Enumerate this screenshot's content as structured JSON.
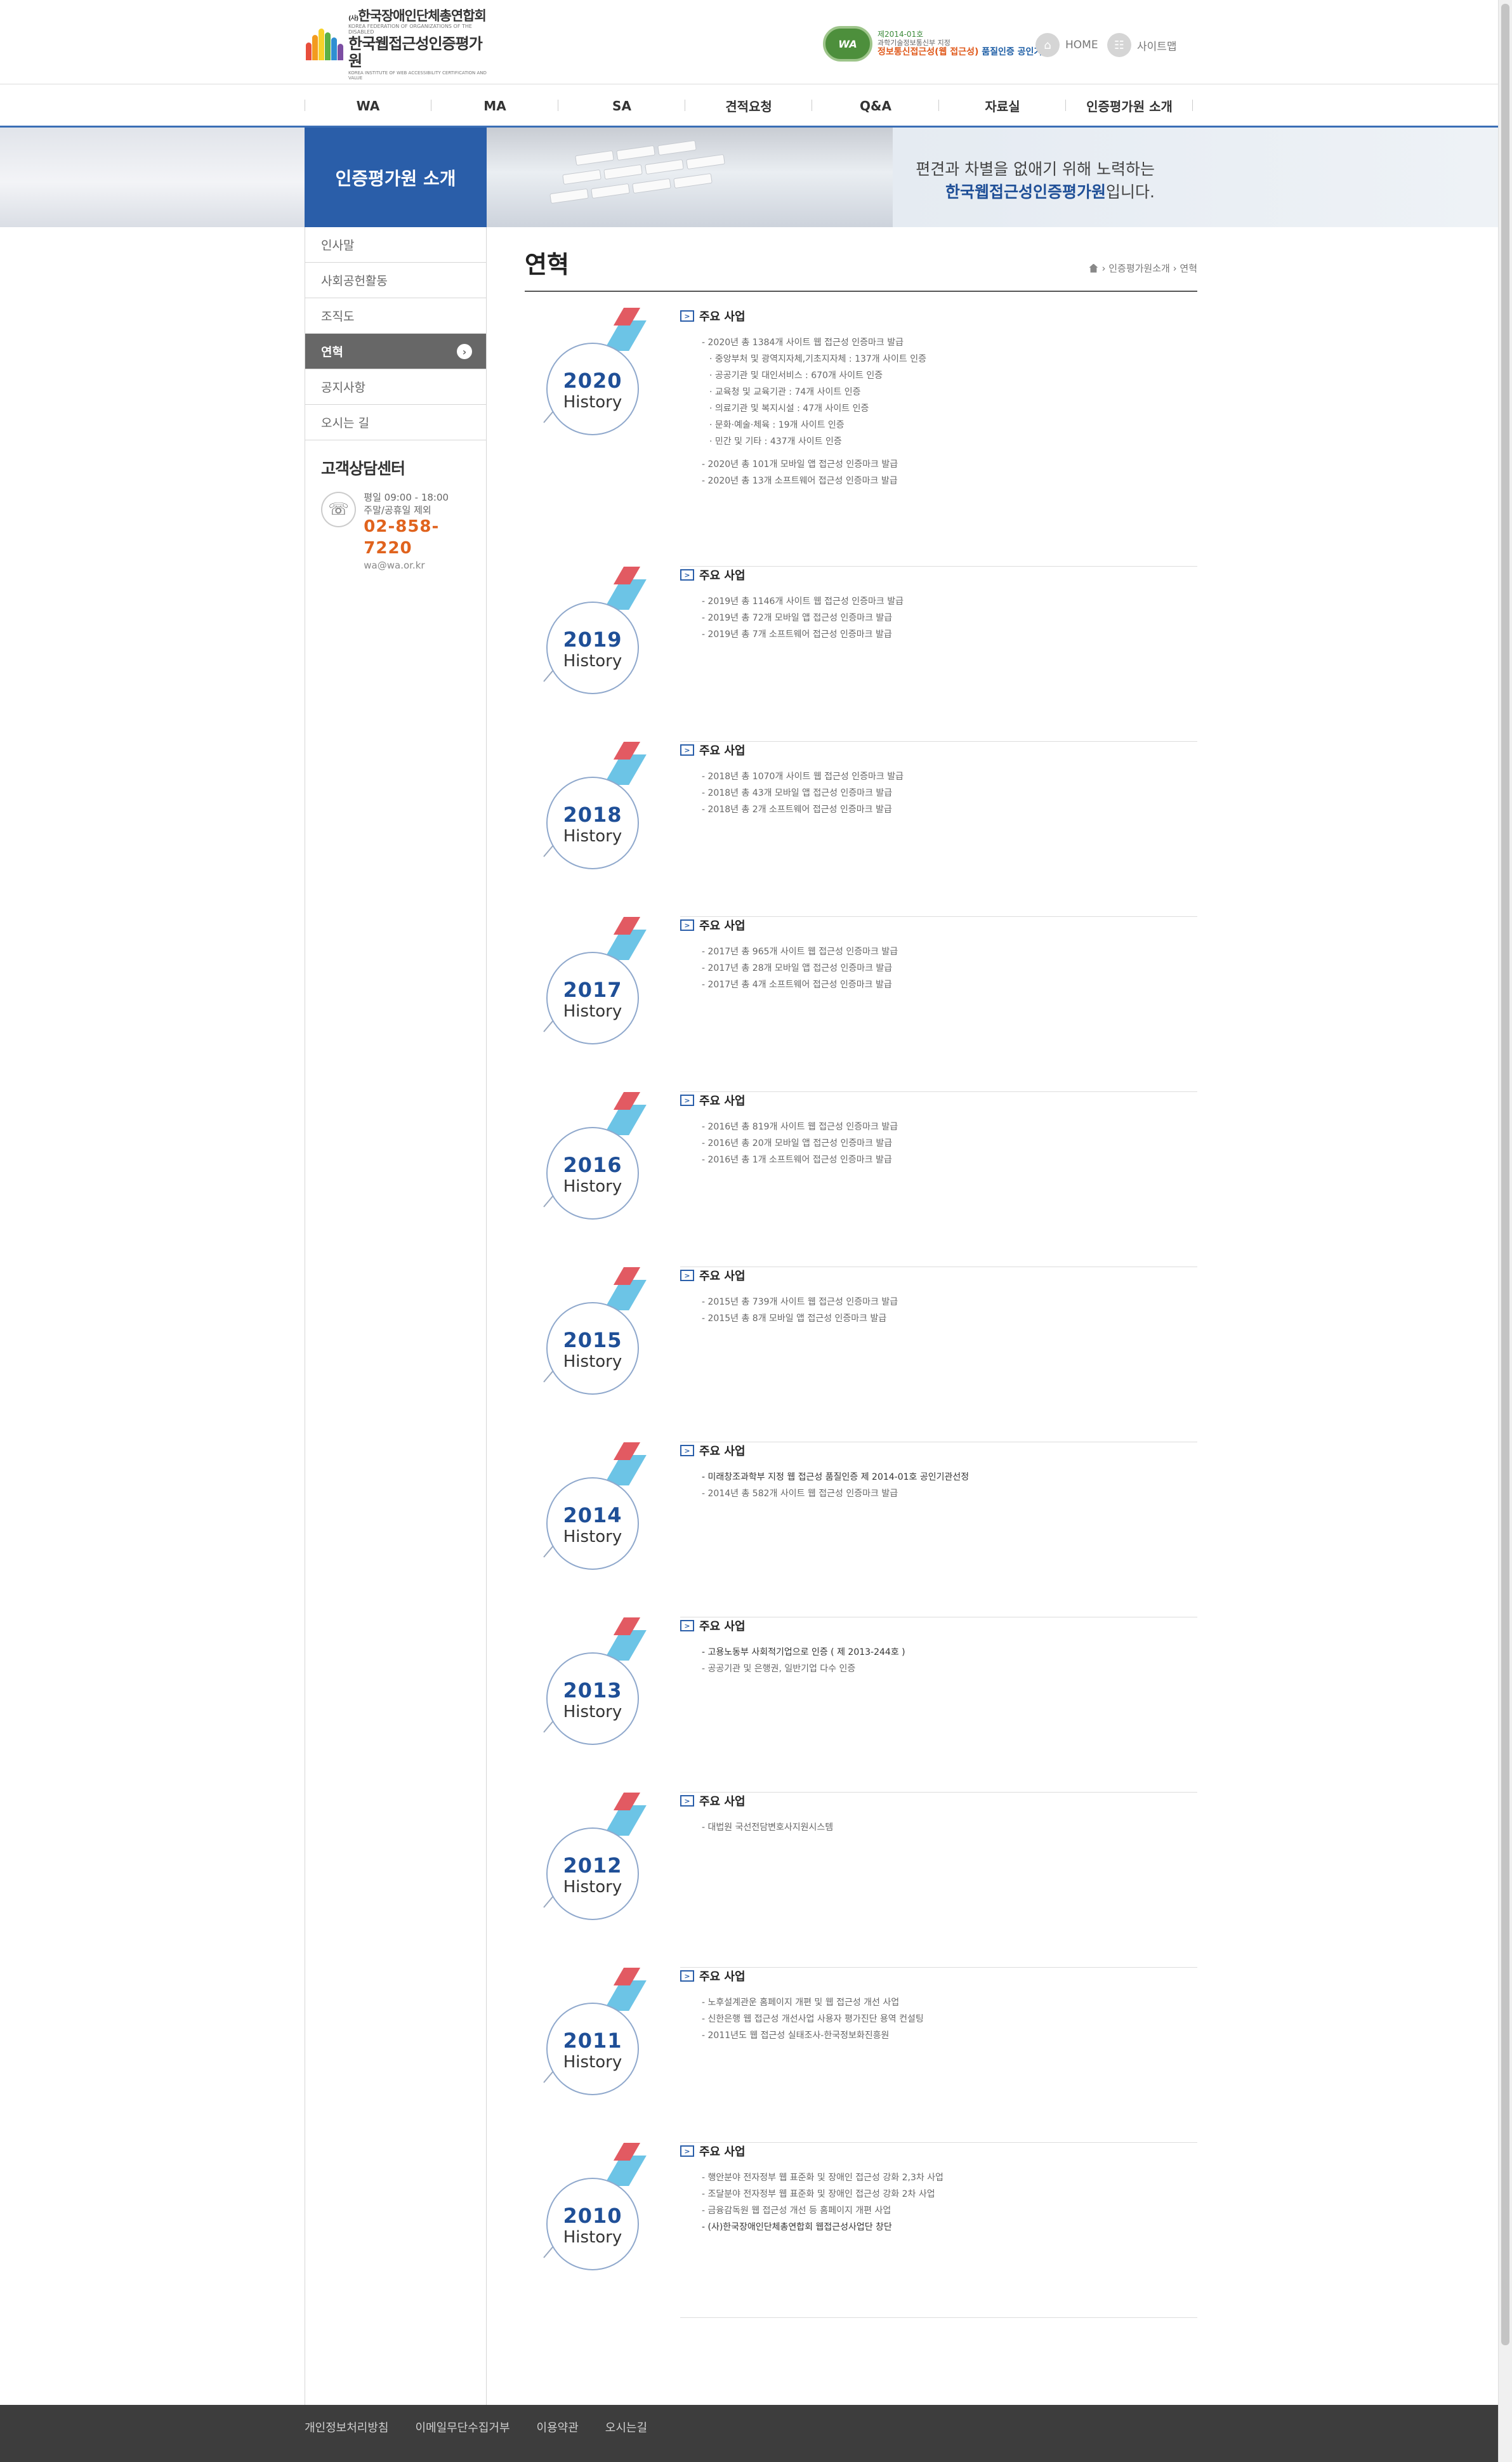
{
  "header": {
    "logo": {
      "org_small": "(사)",
      "org_name": "한국장애인단체총연합회",
      "org_en": "KOREA FEDERATION OF ORGANIZATIONS OF THE DISABLED",
      "brand_name": "한국웹접근성인증평가원",
      "brand_en": "KOREA INSTITUTE OF WEB ACCESSIBILITY CERTIFICATION AND VALUE"
    },
    "cert": {
      "badge": "WA",
      "line1": "제2014-01호",
      "line2": "과학기술정보통신부 지정",
      "line3_a": "정보통신접근성(웹 접근성)",
      "line3_b": "품질인증 공인기관"
    },
    "utils": [
      {
        "label": "HOME",
        "icon": "home-icon"
      },
      {
        "label": "사이트맵",
        "icon": "sitemap-icon"
      }
    ]
  },
  "nav": [
    "WA",
    "MA",
    "SA",
    "견적요청",
    "Q&A",
    "자료실",
    "인증평가원 소개"
  ],
  "banner": {
    "section_title": "인증평가원 소개",
    "copy_line1": "편견과 차별을 없애기 위해 노력하는",
    "copy_line2_strong": "한국웹접근성인증평가원",
    "copy_line2_rest": "입니다."
  },
  "sidebar": {
    "items": [
      {
        "label": "인사말",
        "active": false
      },
      {
        "label": "사회공헌활동",
        "active": false
      },
      {
        "label": "조직도",
        "active": false
      },
      {
        "label": "연혁",
        "active": true
      },
      {
        "label": "공지사항",
        "active": false
      },
      {
        "label": "오시는 길",
        "active": false
      }
    ],
    "cs": {
      "title": "고객상담센터",
      "hours": "평일 09:00 - 18:00",
      "holiday": "주말/공휴일 제외",
      "tel": "02-858-7220",
      "email": "wa@wa.or.kr"
    }
  },
  "page": {
    "title": "연혁",
    "breadcrumb": [
      "인증평가원소개",
      "연혁"
    ]
  },
  "history_label": "History",
  "section_heading": "주요 사업",
  "history": [
    {
      "year": "2020",
      "items": [
        {
          "text": "- 2020년 총 1384개 사이트 웹 접근성 인증마크 발급",
          "type": "main"
        },
        {
          "text": "· 중앙부처 및 광역지자체,기초지자체 : 137개 사이트 인증",
          "type": "sub"
        },
        {
          "text": "· 공공기관 및 대인서비스 : 670개 사이트 인증",
          "type": "sub"
        },
        {
          "text": "· 교육청 및 교육기관 : 74개 사이트 인증",
          "type": "sub"
        },
        {
          "text": "· 의료기관 및 복지시설 : 47개 사이트 인증",
          "type": "sub"
        },
        {
          "text": "· 문화·예술·체육 : 19개 사이트 인증",
          "type": "sub"
        },
        {
          "text": "· 민간 및 기타 : 437개 사이트 인증",
          "type": "sub"
        },
        {
          "text": "- 2020년 총 101개 모바일 앱 접근성 인증마크 발급",
          "type": "gap"
        },
        {
          "text": "- 2020년 총 13개 소프트웨어 접근성 인증마크 발급",
          "type": "main"
        }
      ]
    },
    {
      "year": "2019",
      "items": [
        {
          "text": "- 2019년 총 1146개 사이트 웹 접근성 인증마크 발급",
          "type": "main"
        },
        {
          "text": "- 2019년 총 72개 모바일 앱 접근성 인증마크 발급",
          "type": "main"
        },
        {
          "text": "- 2019년 총 7개 소프트웨어 접근성 인증마크 발급",
          "type": "main"
        }
      ]
    },
    {
      "year": "2018",
      "items": [
        {
          "text": "- 2018년 총 1070개 사이트 웹 접근성 인증마크 발급",
          "type": "main"
        },
        {
          "text": "- 2018년 총 43개 모바일 앱 접근성 인증마크 발급",
          "type": "main"
        },
        {
          "text": "- 2018년 총 2개 소프트웨어 접근성 인증마크 발급",
          "type": "main"
        }
      ]
    },
    {
      "year": "2017",
      "items": [
        {
          "text": "- 2017년 총 965개 사이트 웹 접근성 인증마크 발급",
          "type": "main"
        },
        {
          "text": "- 2017년 총 28개 모바일 앱 접근성 인증마크 발급",
          "type": "main"
        },
        {
          "text": "- 2017년 총 4개 소프트웨어 접근성 인증마크 발급",
          "type": "main"
        }
      ]
    },
    {
      "year": "2016",
      "items": [
        {
          "text": "- 2016년 총 819개 사이트 웹 접근성 인증마크 발급",
          "type": "main"
        },
        {
          "text": "- 2016년 총 20개 모바일 앱 접근성 인증마크 발급",
          "type": "main"
        },
        {
          "text": "- 2016년 총 1개 소프트웨어 접근성 인증마크 발급",
          "type": "main"
        }
      ]
    },
    {
      "year": "2015",
      "items": [
        {
          "text": "- 2015년 총 739개 사이트 웹 접근성 인증마크 발급",
          "type": "main"
        },
        {
          "text": "- 2015년 총 8개 모바일 앱 접근성 인증마크 발급",
          "type": "main"
        }
      ]
    },
    {
      "year": "2014",
      "items": [
        {
          "text": "- 미래창조과학부 지정 웹 접근성 품질인증 제 2014-01호 공인기관선정",
          "type": "strong"
        },
        {
          "text": "- 2014년 총 582개 사이트 웹 접근성 인증마크 발급",
          "type": "main"
        }
      ]
    },
    {
      "year": "2013",
      "items": [
        {
          "text": "- 고용노동부 사회적기업으로 인증 ( 제 2013-244호 )",
          "type": "strong"
        },
        {
          "text": "- 공공기관 및 은행권, 일반기업 다수 인증",
          "type": "main"
        }
      ]
    },
    {
      "year": "2012",
      "items": [
        {
          "text": "- 대법원 국선전담변호사지원시스템",
          "type": "main"
        }
      ]
    },
    {
      "year": "2011",
      "items": [
        {
          "text": "- 노후설계관운 홈페이지 개편 및 웹 접근성 개선 사업",
          "type": "main"
        },
        {
          "text": "- 신한은행 웹 접근성 개선사업 사용자 평가진단 용역 컨설팅",
          "type": "main"
        },
        {
          "text": "- 2011년도 웹 접근성 실태조사-한국정보화진흥원",
          "type": "main"
        }
      ]
    },
    {
      "year": "2010",
      "items": [
        {
          "text": "- 행안분야 전자정부 웹 표준화 및 장애인 접근성 강화 2,3차 사업",
          "type": "main"
        },
        {
          "text": "- 조달분야 전자정부 웹 표준화 및 장애인 접근성 강화 2차 사업",
          "type": "main"
        },
        {
          "text": "- 금융감독원 웹 접근성 개선 등 홈페이지 개편 사업",
          "type": "main"
        },
        {
          "text": "- (사)한국장애인단체총연합회 웹접근성사업단 창단",
          "type": "strong"
        }
      ]
    }
  ],
  "footer": [
    "개인정보처리방침",
    "이메일무단수집거부",
    "이용약관",
    "오시는길"
  ],
  "colors": {
    "primary": "#2a5ea9",
    "accent": "#e0631e",
    "footer": "#3d3d3d"
  }
}
